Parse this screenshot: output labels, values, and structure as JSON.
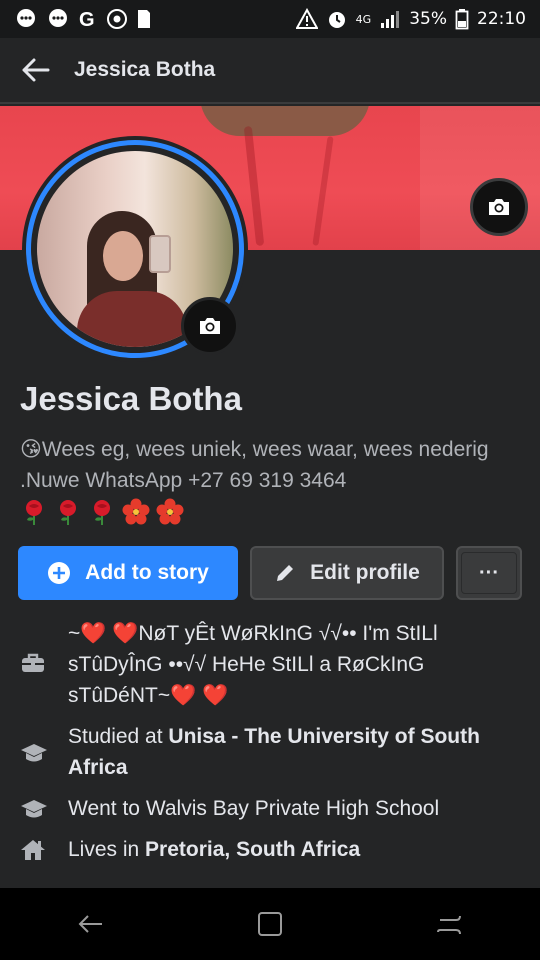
{
  "status_bar": {
    "battery": "35%",
    "time": "22:10",
    "network": "4G"
  },
  "header": {
    "title": "Jessica Botha"
  },
  "profile": {
    "name": "Jessica Botha",
    "bio_emoji": "😘",
    "bio_text": "Wees eg, wees uniek, wees waar, wees nederig .Nuwe WhatsApp +27 69 319 3464",
    "bio_flowers": "🌹🌹🌹🌺🌺"
  },
  "actions": {
    "add_story_label": "Add to story",
    "edit_profile_label": "Edit profile",
    "more_label": "···"
  },
  "details": {
    "work": "~❤️ ❤️NøT yÊt WøRkInG √√•• I'm StILl sTûDyÎnG ••√√ HeHe StILl a RøCkInG sTûDéNT~❤️ ❤️",
    "studied_prefix": "Studied at ",
    "studied_school": "Unisa - The University of South Africa",
    "went_to": "Went to Walvis Bay Private High School",
    "lives_prefix": "Lives in ",
    "lives_city": "Pretoria, South Africa"
  },
  "colors": {
    "accent": "#2d88ff",
    "background": "#242526",
    "button_secondary": "#3a3b3c",
    "cover": "#ef4c55"
  },
  "icons": {
    "back": "arrow-left-icon",
    "camera": "camera-icon",
    "work": "briefcase-icon",
    "study": "graduation-cap-icon",
    "home": "home-icon",
    "add": "plus-circle-icon",
    "edit": "pencil-icon"
  }
}
